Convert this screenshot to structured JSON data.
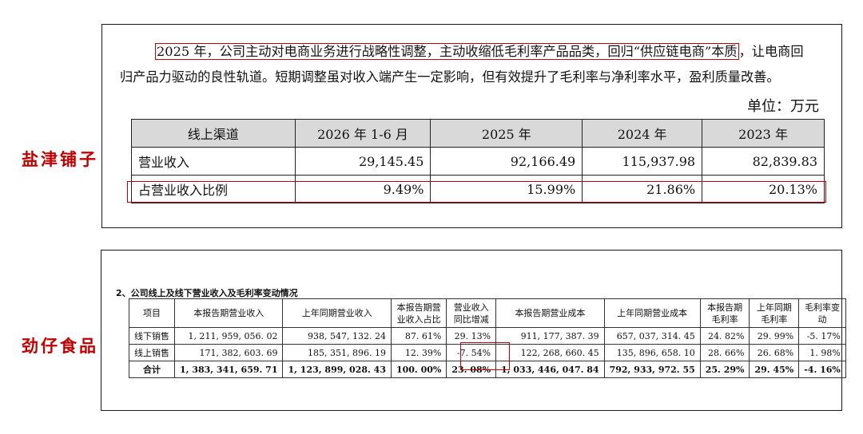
{
  "labels": {
    "company1": "盐津铺子",
    "company2": "劲仔食品"
  },
  "doc1": {
    "para_highlight": "2025 年，公司主动对电商业务进行战略性调整，主动收缩低毛利率产品品类，回归“供应链电商”本质",
    "para_line1_rest": "，让电商回",
    "para_line2": "归产品力驱动的良性轨道。短期调整虽对收入端产生一定影响，但有效提升了毛利率与净利率水平，盈利质量改善。",
    "unit": "单位：万元",
    "headers": [
      "线上渠道",
      "2026 年 1-6 月",
      "2025 年",
      "2024 年",
      "2023 年"
    ],
    "rows": [
      [
        "营业收入",
        "29,145.45",
        "92,166.49",
        "115,937.98",
        "82,839.83"
      ],
      [
        "占营业收入比例",
        "9.49%",
        "15.99%",
        "21.86%",
        "20.13%"
      ]
    ]
  },
  "doc2": {
    "title": "2、公司线上及线下营业收入及毛利率变动情况",
    "headers": [
      "项目",
      "本报告期营业收入",
      "上年同期营业收入",
      "本报告期营业收入占比",
      "营业收入同比增减",
      "本报告期营业成本",
      "上年同期营业成本",
      "本报告期毛利率",
      "上年同期毛利率",
      "毛利率变动"
    ],
    "rows": [
      [
        "线下销售",
        "1, 211, 959, 056. 02",
        "938, 547, 132. 24",
        "87. 61%",
        "29. 13%",
        "911, 177, 387. 39",
        "657, 037, 314. 45",
        "24. 82%",
        "29. 99%",
        "-5. 17%"
      ],
      [
        "线上销售",
        "171, 382, 603. 69",
        "185, 351, 896. 19",
        "12. 39%",
        "-7. 54%",
        "122, 268, 660. 45",
        "135, 896, 658. 10",
        "28. 66%",
        "26. 68%",
        "1. 98%"
      ],
      [
        "合计",
        "1, 383, 341, 659. 71",
        "1, 123, 899, 028. 43",
        "100. 00%",
        "23. 08%",
        "1, 033, 446, 047. 84",
        "792, 933, 972. 55",
        "25. 29%",
        "29. 45%",
        "-4. 16%"
      ]
    ]
  },
  "colors": {
    "highlight": "#c00000",
    "header_bg": "#d9d9d9"
  }
}
